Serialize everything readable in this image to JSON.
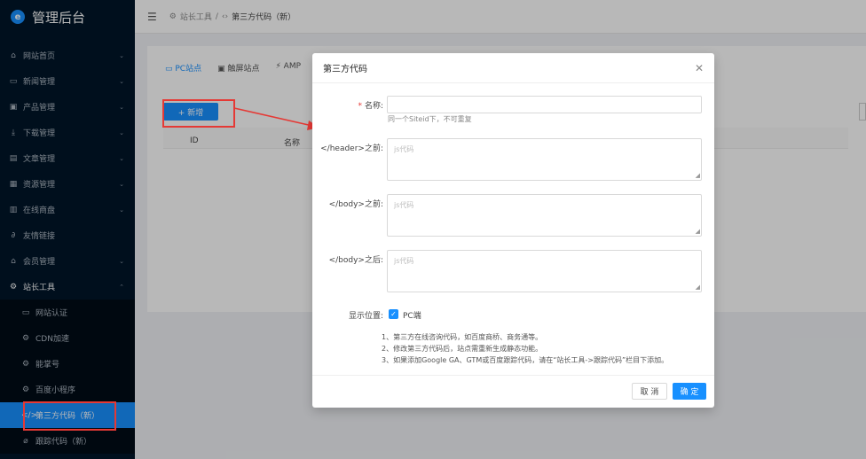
{
  "app": {
    "title": "管理后台",
    "logo_letter": "e"
  },
  "sidebar": {
    "items": [
      {
        "label": "网站首页",
        "icon": "⌂"
      },
      {
        "label": "新闻管理",
        "icon": "▭"
      },
      {
        "label": "产品管理",
        "icon": "▣"
      },
      {
        "label": "下载管理",
        "icon": "⤓"
      },
      {
        "label": "文章管理",
        "icon": "▤"
      },
      {
        "label": "资源管理",
        "icon": "▦"
      },
      {
        "label": "在线商盘",
        "icon": "▥"
      },
      {
        "label": "友情链接",
        "icon": "∂"
      },
      {
        "label": "会员管理",
        "icon": "⌂"
      },
      {
        "label": "站长工具",
        "icon": "⚙"
      }
    ],
    "subitems": [
      {
        "label": "网站认证",
        "icon": "▭"
      },
      {
        "label": "CDN加速",
        "icon": "⚙"
      },
      {
        "label": "能掌号",
        "icon": "⚙"
      },
      {
        "label": "百度小程序",
        "icon": "⚙"
      },
      {
        "label": "第三方代码（新）",
        "icon": "</>"
      },
      {
        "label": "跟踪代码（新）",
        "icon": "⌀"
      }
    ]
  },
  "topbar": {
    "crumb_parent": "站长工具",
    "separator": "/",
    "crumb_current": "第三方代码（新）"
  },
  "page": {
    "tabs": [
      "PC站点",
      "触屏站点",
      "AMP"
    ],
    "add_label": "+ 新增",
    "columns": [
      "ID",
      "名称"
    ]
  },
  "modal": {
    "title": "第三方代码",
    "name_label": "名称:",
    "name_hint": "同一个Siteid下，不可重复",
    "header_label": "</header>之前:",
    "body_before_label": "</body>之前:",
    "body_after_label": "</body>之后:",
    "placeholder": "js代码",
    "display_label": "显示位置:",
    "pc_label": "PC端",
    "notes": [
      "1、第三方在线咨询代码，如百度商桥、商务通等。",
      "2、修改第三方代码后，站点需重新生成静态功能。",
      "3、如果添加Google GA、GTM或百度跟踪代码，请在“站长工具->跟踪代码”栏目下添加。"
    ],
    "cancel": "取 消",
    "ok": "确 定"
  },
  "colors": {
    "primary": "#1890ff",
    "sidebar_bg": "#001529",
    "annotation": "#e53935"
  }
}
